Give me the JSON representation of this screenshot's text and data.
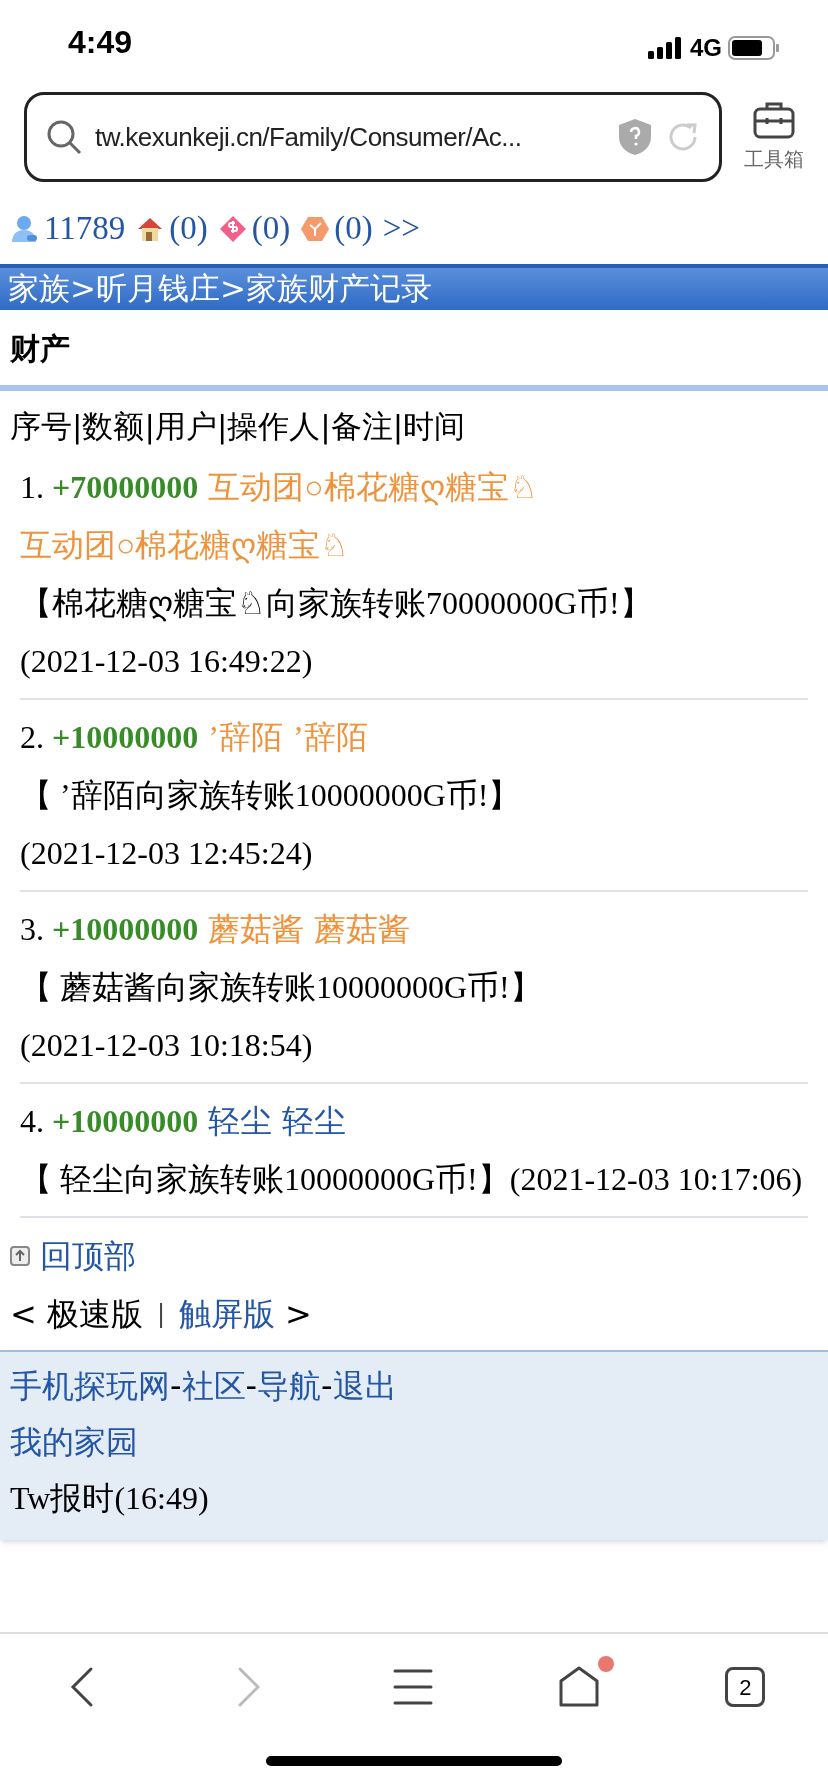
{
  "status_bar": {
    "time": "4:49",
    "network": "4G"
  },
  "address_bar": {
    "url": "tw.kexunkeji.cn/Family/Consumer/Ac...",
    "toolbox_label": "工具箱"
  },
  "stats": [
    {
      "kind": "user",
      "value": "11789"
    },
    {
      "kind": "house",
      "value": "(0)"
    },
    {
      "kind": "diamond",
      "value": "(0)"
    },
    {
      "kind": "hexagon",
      "value": "(0)"
    }
  ],
  "stats_more": ">>",
  "breadcrumb": "家族>昕月钱庄>家族财产记录",
  "section_title": "财产",
  "columns_header": "序号|数额|用户|操作人|备注|时间",
  "records": [
    {
      "index": "1.",
      "amount": "+70000000",
      "user": "互动团○棉花糖ღ糖宝♘",
      "operator": "互动团○棉花糖ღ糖宝♘",
      "note": "【棉花糖ღ糖宝♘向家族转账70000000G币!】",
      "time": "(2021-12-03 16:49:22)",
      "color": "#f0923a"
    },
    {
      "index": "2.",
      "amount": "+10000000",
      "user": "’辞陌",
      "operator": "’辞陌",
      "note": "【 ’辞陌向家族转账10000000G币!】",
      "time": "(2021-12-03 12:45:24)",
      "color": "#f0923a"
    },
    {
      "index": "3.",
      "amount": "+10000000",
      "user": "蘑菇酱",
      "operator": "蘑菇酱",
      "note": "【 蘑菇酱向家族转账10000000G币!】",
      "time": "(2021-12-03 10:18:54)",
      "color": "#f0923a"
    },
    {
      "index": "4.",
      "amount": "+10000000",
      "user": "轻尘",
      "operator": "轻尘",
      "note": "【 轻尘向家族转账10000000G币!】",
      "time": "(2021-12-03 10:17:06)",
      "color": "#2456a6"
    }
  ],
  "back_to_top": "回顶部",
  "version_links": [
    {
      "kind": "text",
      "text": "< 极速版"
    },
    {
      "kind": "sep",
      "text": "|"
    },
    {
      "kind": "link",
      "text": "触屏版"
    },
    {
      "kind": "text",
      "text": ">"
    }
  ],
  "footer_nav": [
    {
      "kind": "link",
      "text": "手机探玩网"
    },
    {
      "kind": "sep",
      "text": "-"
    },
    {
      "kind": "link",
      "text": "社区"
    },
    {
      "kind": "sep",
      "text": "-"
    },
    {
      "kind": "link",
      "text": "导航"
    },
    {
      "kind": "sep",
      "text": "-"
    },
    {
      "kind": "link",
      "text": "退出"
    }
  ],
  "home_link": "我的家园",
  "clock": "Tw报时(16:49)",
  "browser_bar": {
    "tab_count": "2",
    "home_badge": true,
    "forward_disabled": true
  }
}
